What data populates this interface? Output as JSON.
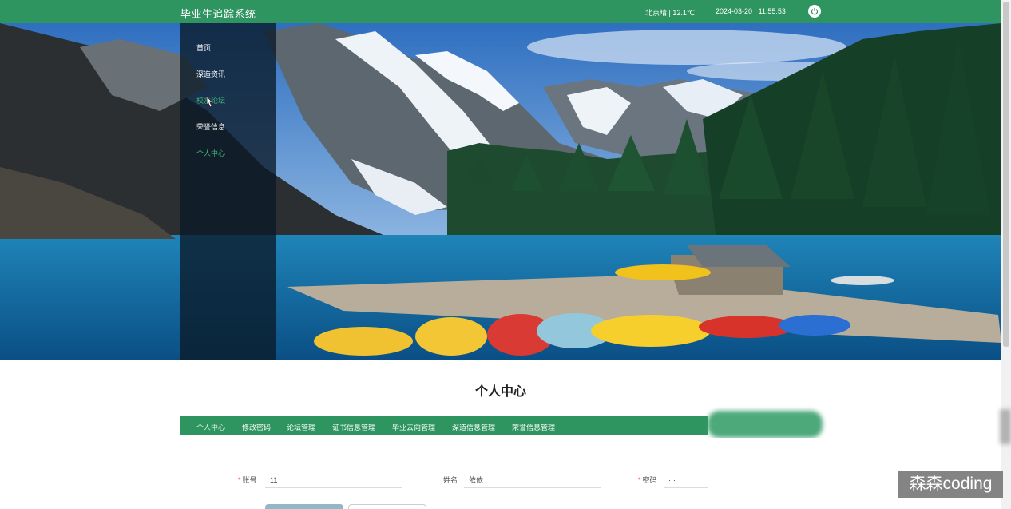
{
  "header": {
    "app_title": "毕业生追踪系统",
    "weather": "北京晴 | 12.1℃",
    "date": "2024-03-20",
    "time": "11:55:53"
  },
  "sidenav": {
    "items": [
      {
        "label": "首页",
        "active": false
      },
      {
        "label": "深造资讯",
        "active": false
      },
      {
        "label": "校友论坛",
        "active": true
      },
      {
        "label": "荣誉信息",
        "active": false
      },
      {
        "label": "个人中心",
        "active": true
      }
    ]
  },
  "main": {
    "page_title": "个人中心",
    "tabs": [
      {
        "label": "个人中心",
        "active": true
      },
      {
        "label": "修改密码",
        "active": false
      },
      {
        "label": "论坛管理",
        "active": false
      },
      {
        "label": "证书信息管理",
        "active": false
      },
      {
        "label": "毕业去向管理",
        "active": false
      },
      {
        "label": "深造信息管理",
        "active": false
      },
      {
        "label": "荣誉信息管理",
        "active": false
      }
    ],
    "form": {
      "account_label": "账号",
      "account_value": "11",
      "name_label": "姓名",
      "name_value": "依依",
      "password_label": "密码",
      "password_value": "···"
    }
  },
  "watermark": "森森coding",
  "colors": {
    "brand_green": "#2e9460",
    "active_green": "#3fb07a",
    "required_red": "#e05050"
  }
}
